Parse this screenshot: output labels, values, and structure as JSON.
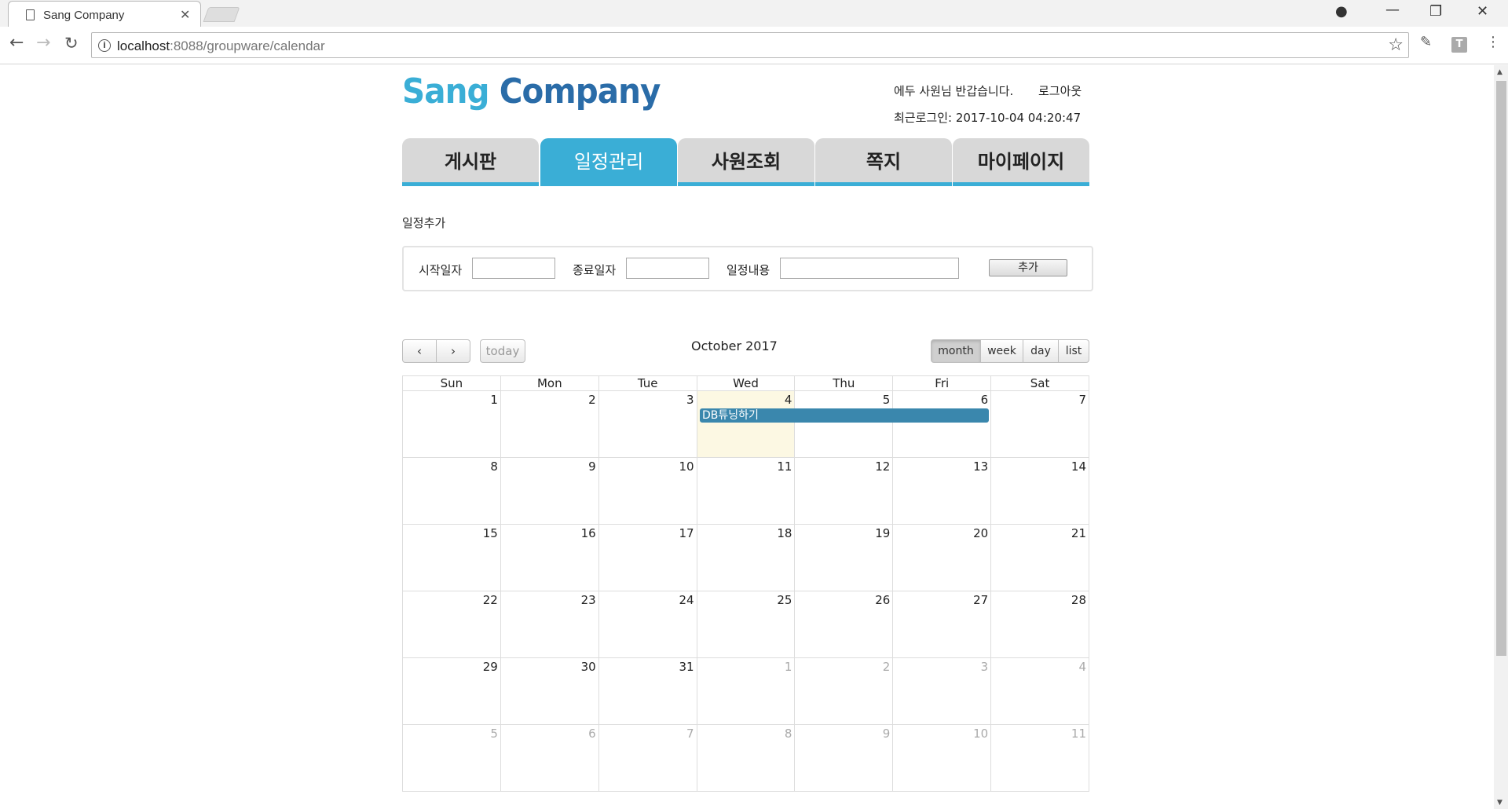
{
  "browser": {
    "tab_title": "Sang Company",
    "url_host": "localhost",
    "url_rest": ":8088/groupware/calendar"
  },
  "header": {
    "logo_part1": "Sang",
    "logo_part2": "Company",
    "greeting": "에두 사원님 반갑습니다.",
    "logout": "로그아웃",
    "last_login": "최근로그인: 2017-10-04 04:20:47"
  },
  "menu": {
    "items": [
      "게시판",
      "일정관리",
      "사원조회",
      "쪽지",
      "마이페이지"
    ],
    "active": "일정관리"
  },
  "add_schedule": {
    "title": "일정추가",
    "start_label": "시작일자",
    "end_label": "종료일자",
    "content_label": "일정내용",
    "add_button": "추가"
  },
  "calendar": {
    "title": "October 2017",
    "today_button": "today",
    "views": [
      "month",
      "week",
      "day",
      "list"
    ],
    "active_view": "month",
    "weekdays": [
      "Sun",
      "Mon",
      "Tue",
      "Wed",
      "Thu",
      "Fri",
      "Sat"
    ],
    "weeks": [
      [
        "1",
        "2",
        "3",
        "4",
        "5",
        "6",
        "7"
      ],
      [
        "8",
        "9",
        "10",
        "11",
        "12",
        "13",
        "14"
      ],
      [
        "15",
        "16",
        "17",
        "18",
        "19",
        "20",
        "21"
      ],
      [
        "22",
        "23",
        "24",
        "25",
        "26",
        "27",
        "28"
      ],
      [
        "29",
        "30",
        "31",
        "1",
        "2",
        "3",
        "4"
      ],
      [
        "5",
        "6",
        "7",
        "8",
        "9",
        "10",
        "11"
      ]
    ],
    "today": "2017-10-04",
    "events": [
      {
        "title": "DB튜닝하기",
        "start": "2017-10-04",
        "end": "2017-10-06"
      }
    ]
  },
  "colors": {
    "accent": "#3aaed6",
    "event": "#3a87ad",
    "today_bg": "#fcf8e3"
  }
}
